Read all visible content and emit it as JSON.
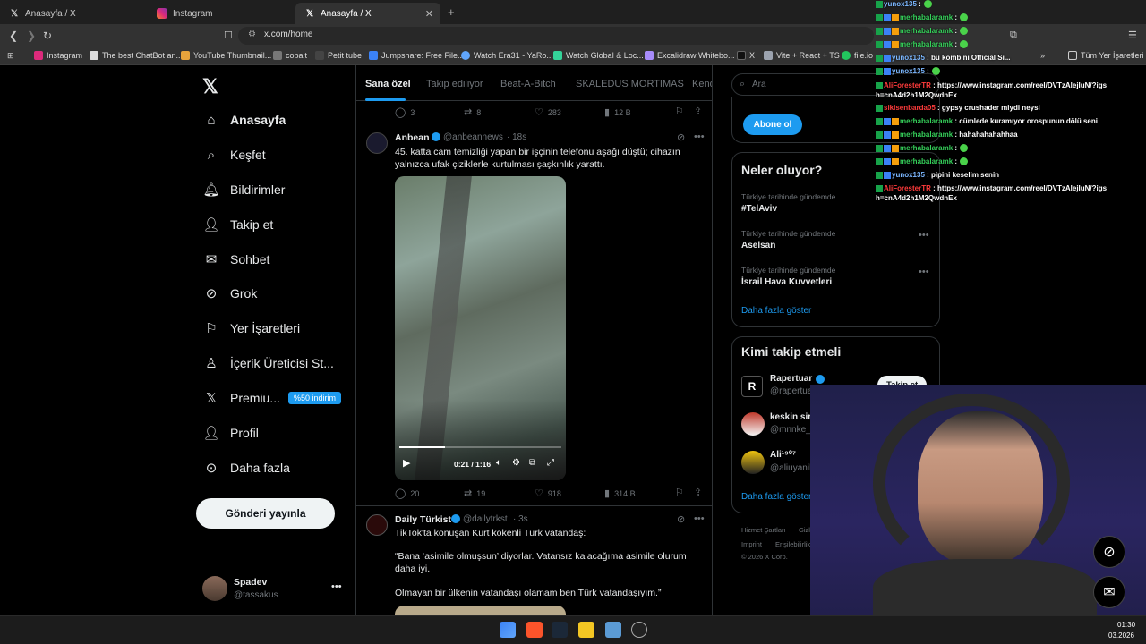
{
  "browser": {
    "tabs": [
      {
        "title": "Anasayfa / X",
        "icon": "x-logo-icon"
      },
      {
        "title": "Instagram",
        "icon": "instagram-icon"
      },
      {
        "title": "Anasayfa / X",
        "icon": "x-logo-icon",
        "active": true
      }
    ],
    "url": "x.com/home",
    "bookmarks": [
      "Instagram",
      "The best ChatBot an...",
      "YouTube Thumbnail...",
      "cobalt",
      "Petit tube",
      "Jumpshare: Free File...",
      "Watch Era31 - YaRo...",
      "Watch Global & Loc...",
      "Excalidraw Whitebo...",
      "X",
      "Vite + React + TS",
      "file.io"
    ],
    "bookmarks_folder": "Tüm Yer İşaretleri"
  },
  "nav": {
    "home": "Anasayfa",
    "explore": "Keşfet",
    "notifications": "Bildirimler",
    "follow": "Takip et",
    "chat": "Sohbet",
    "grok": "Grok",
    "bookmarks": "Yer İşaretleri",
    "creator": "İçerik Üreticisi St...",
    "premium": "Premiu...",
    "premium_badge": "%50 indirim",
    "profile": "Profil",
    "more": "Daha fazla",
    "post_button": "Gönderi yayınla",
    "user_name": "Spadev",
    "user_handle": "@tassakus"
  },
  "feed": {
    "tabs": [
      "Sana özel",
      "Takip ediliyor",
      "Beat-A-Bitch",
      "SKALEDUS MORTIMAS",
      "Kend"
    ],
    "top_metrics": {
      "replies": "3",
      "reposts": "8",
      "likes": "283",
      "views": "12 B"
    },
    "post1": {
      "name": "Anbean",
      "handle": "@anbeannews",
      "time": "· 18s",
      "text": "45. katta cam temizliği yapan bir işçinin telefonu aşağı düştü; cihazın yalnızca ufak çiziklerle kurtulması şaşkınlık yarattı.",
      "video_time": "0:21 / 1:16",
      "progress": 0.28,
      "replies": "20",
      "reposts": "19",
      "likes": "918",
      "views": "314 B"
    },
    "post2": {
      "name": "Daily Türkist",
      "handle": "@dailytrkst",
      "time": "· 3s",
      "line1": "TikTok'ta konuşan Kürt kökenli Türk vatandaş:",
      "line2": "“Bana ‘asimile olmuşsun’ diyorlar. Vatansız kalacağıma asimile olurum daha iyi.",
      "line3": "Olmayan bir ülkenin vatandaşı olamam ben Türk vatandaşıyım.”"
    }
  },
  "right": {
    "search_placeholder": "Ara",
    "subscribe": "Abone ol",
    "trends_title": "Neler oluyor?",
    "trends": [
      {
        "meta": "Türkiye tarihinde gündemde",
        "name": "#TelAviv"
      },
      {
        "meta": "Türkiye tarihinde gündemde",
        "name": "Aselsan"
      },
      {
        "meta": "Türkiye tarihinde gündemde",
        "name": "İsrail Hava Kuvvetleri"
      }
    ],
    "show_more": "Daha fazla göster",
    "who_title": "Kimi takip etmeli",
    "who": [
      {
        "name": "Rapertuar",
        "handle": "@rapertuarcom"
      },
      {
        "name": "keskin sirke",
        "handle": "@mnnke_1"
      },
      {
        "name": "Ali¹⁹⁰⁷",
        "handle": "@aliuyanik06"
      }
    ],
    "follow_label": "Takip et",
    "who_more": "Daha fazla göster",
    "footer": [
      "Hizmet Şartları",
      "Gizlilik Po",
      "Imprint",
      "Erişilebilirlik",
      "© 2026 X Corp."
    ]
  },
  "chat": [
    {
      "user": "yunox135",
      "msg": ":",
      "color": "b"
    },
    {
      "user": "merhabalaramk",
      "msg": ":",
      "color": "g"
    },
    {
      "user": "merhabalaramk",
      "msg": ":",
      "color": "g"
    },
    {
      "user": "merhabalaramk",
      "msg": ":",
      "color": "g"
    },
    {
      "user": "yunox135",
      "msg": ": bu kombini Official Si...",
      "color": "b"
    },
    {
      "user": "yunox135",
      "msg": ":",
      "color": "b"
    },
    {
      "user": "AliForesterTR",
      "msg": ": https://www.instagram.com/reel/DVTzAlejIuN/?igsh=cnA4d2h1M2QwdnEx",
      "color": "r"
    },
    {
      "user": "sikisenbarda05",
      "msg": ": gypsy crushader miydi neysi",
      "color": "r"
    },
    {
      "user": "merhabalaramk",
      "msg": ": cümlede kuramıyor orospunun dölü seni",
      "color": "g"
    },
    {
      "user": "merhabalaramk",
      "msg": ": hahahahahahhaa",
      "color": "g"
    },
    {
      "user": "merhabalaramk",
      "msg": ":",
      "color": "g"
    },
    {
      "user": "merhabalaramk",
      "msg": ":",
      "color": "g"
    },
    {
      "user": "yunox135",
      "msg": ": pipini keselim senin",
      "color": "b"
    },
    {
      "user": "AliForesterTR",
      "msg": ": https://www.instagram.com/reel/DVTzAlejIuN/?igsh=cnA4d2h1M2QwdnEx",
      "color": "r"
    }
  ],
  "taskbar": {
    "time": "01:30",
    "date": "03.2026"
  },
  "colors": {
    "accent": "#1d9bf0",
    "bg": "#000000",
    "border": "#2f3336",
    "muted": "#71767b"
  }
}
